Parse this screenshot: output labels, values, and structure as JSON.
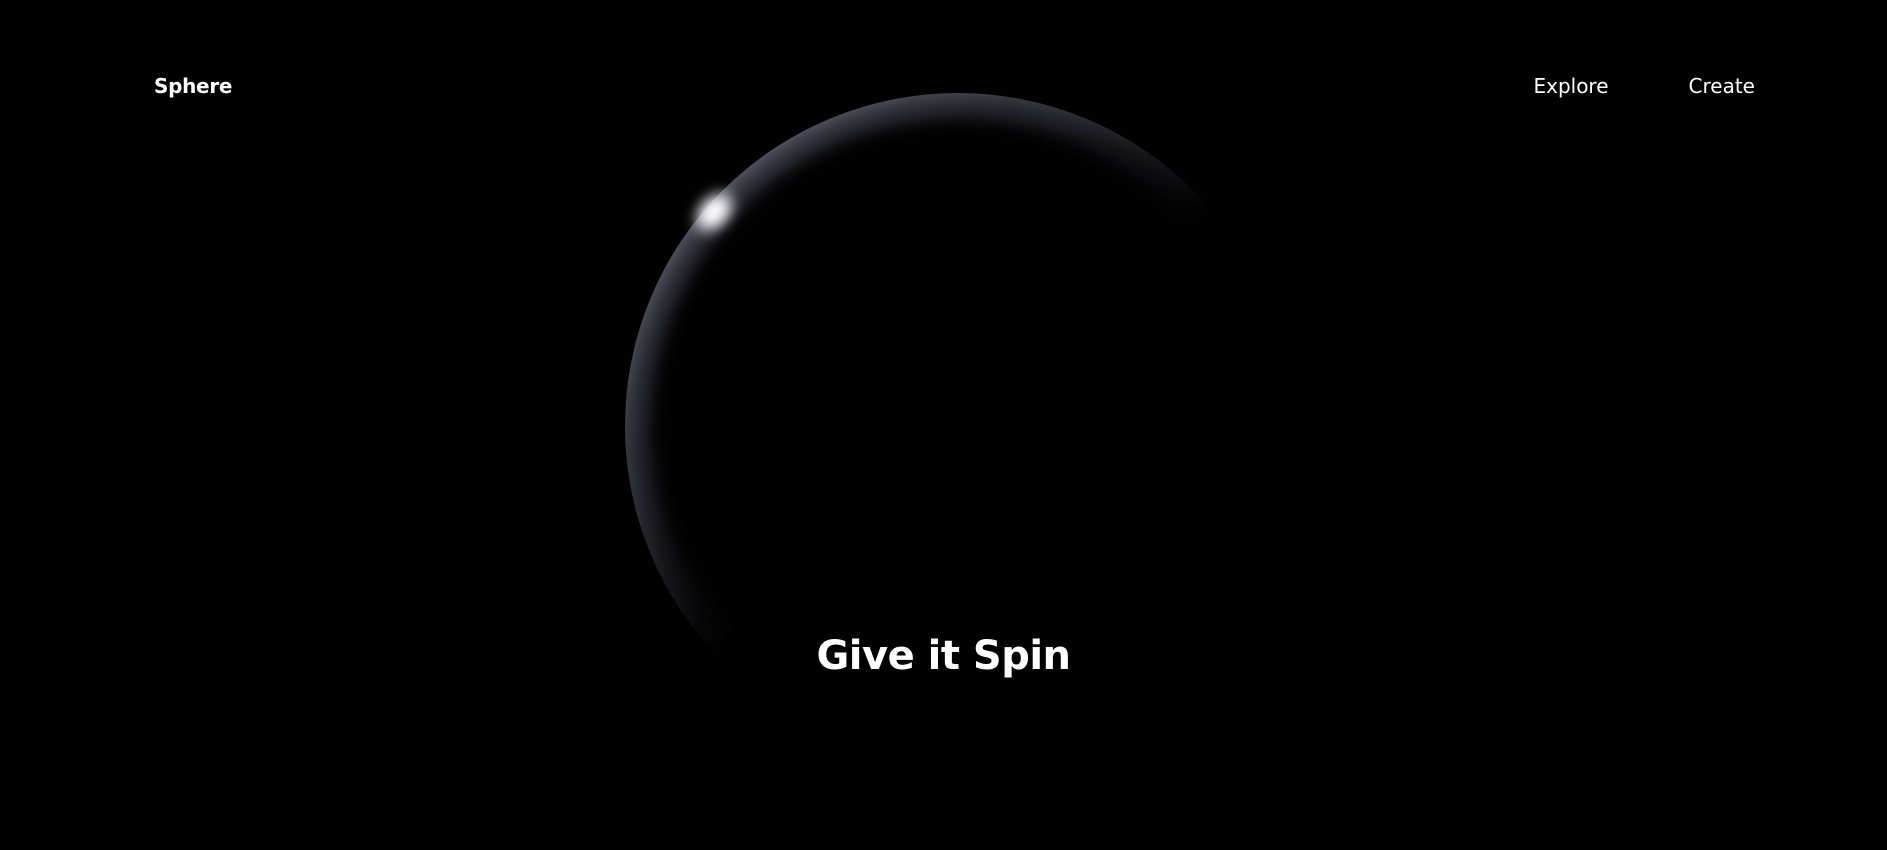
{
  "nav": {
    "brand": "Sphere",
    "links": [
      {
        "label": "Explore"
      },
      {
        "label": "Create"
      }
    ]
  },
  "hero": {
    "headline": "Give it Spin"
  },
  "colors": {
    "background": "#000000",
    "text": "#ffffff",
    "sphere_rim": "#4a4a58",
    "highlight": "#ffffff"
  }
}
